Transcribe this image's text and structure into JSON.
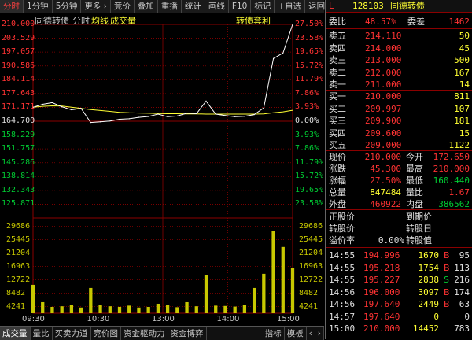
{
  "toolbar": {
    "tabs": [
      "分时",
      "1分钟",
      "5分钟",
      "更多 ›",
      "竞价",
      "叠加",
      "重播",
      "统计",
      "画线",
      "F10",
      "标记",
      "+自选",
      "返回"
    ]
  },
  "chart": {
    "title": "同德转债",
    "mode_label": "分时",
    "avg_label": "均线",
    "vol_label": "成交量",
    "arb_label": "转债套利",
    "price_ticks": [
      "210.000",
      "203.529",
      "197.057",
      "190.586",
      "184.114",
      "177.643",
      "171.171",
      "164.700",
      "158.229",
      "151.757",
      "145.286",
      "138.814",
      "132.343",
      "125.871"
    ],
    "pct_ticks": [
      "27.50%",
      "23.58%",
      "19.65%",
      "15.72%",
      "11.79%",
      "7.86%",
      "3.93%",
      "0.00%",
      "3.93%",
      "7.86%",
      "11.79%",
      "15.72%",
      "19.65%",
      "23.58%"
    ],
    "vol_ticks": [
      "29686",
      "25445",
      "21204",
      "16963",
      "12722",
      "8482",
      "4241"
    ],
    "time_ticks": [
      "09:30",
      "10:30",
      "13:00",
      "14:00",
      "15:00"
    ],
    "colors": {
      "up": "#ff3333",
      "down": "#00cc33",
      "price_line": "#ffffff",
      "avg_line": "#ffff33",
      "volume": "#c8c800"
    }
  },
  "chart_data": {
    "type": "line",
    "prev_close": 164.7,
    "ylim": [
      125.871,
      210.0
    ],
    "x": [
      "09:30",
      "09:40",
      "09:50",
      "10:00",
      "10:10",
      "10:20",
      "10:30",
      "10:40",
      "10:50",
      "11:00",
      "11:10",
      "11:20",
      "11:30/13:00",
      "13:10",
      "13:20",
      "13:30",
      "13:40",
      "13:50",
      "14:00",
      "14:10",
      "14:20",
      "14:30",
      "14:40",
      "14:50",
      "14:53",
      "14:55",
      "14:57",
      "15:00"
    ],
    "series": [
      {
        "values": [
          174.0,
          175.3,
          176.0,
          174.2,
          172.9,
          173.5,
          167.4,
          167.7,
          168.0,
          168.8,
          169.0,
          169.6,
          170.0,
          171.0,
          169.9,
          170.2,
          171.4,
          171.2,
          176.7,
          171.0,
          170.4,
          169.9,
          170.1,
          170.8,
          173.7,
          195.2,
          197.6,
          210.0
        ]
      },
      {
        "values": [
          174.0,
          174.4,
          174.6,
          174.5,
          174.0,
          173.5,
          173.0,
          172.6,
          172.2,
          171.8,
          171.6,
          171.5,
          171.4,
          171.3,
          171.2,
          171.2,
          171.1,
          171.1,
          171.0,
          171.0,
          171.0,
          171.0,
          171.0,
          171.0,
          171.1,
          171.6,
          172.0,
          172.7
        ]
      }
    ],
    "volume": {
      "ylim": [
        0,
        29686
      ],
      "values": [
        9000,
        3500,
        2000,
        2200,
        2500,
        1800,
        8000,
        2600,
        2200,
        2000,
        2400,
        1800,
        2000,
        3000,
        2600,
        1900,
        3500,
        2200,
        12000,
        2400,
        2300,
        2100,
        2600,
        8000,
        12500,
        26000,
        21000,
        14452
      ]
    }
  },
  "panel": {
    "stock": {
      "flag": "L",
      "code": "128103",
      "name": "同德转债"
    },
    "weibi": {
      "label": "委比",
      "value": "48.57%",
      "label2": "委差",
      "value2": "1462"
    },
    "asks": [
      {
        "label": "卖五",
        "price": "214.110",
        "vol": "50"
      },
      {
        "label": "卖四",
        "price": "214.000",
        "vol": "45"
      },
      {
        "label": "卖三",
        "price": "213.000",
        "vol": "500"
      },
      {
        "label": "卖二",
        "price": "212.000",
        "vol": "167"
      },
      {
        "label": "卖一",
        "price": "211.000",
        "vol": "14"
      }
    ],
    "bids": [
      {
        "label": "买一",
        "price": "210.000",
        "vol": "811"
      },
      {
        "label": "买二",
        "price": "209.997",
        "vol": "107"
      },
      {
        "label": "买三",
        "price": "209.900",
        "vol": "181"
      },
      {
        "label": "买四",
        "price": "209.600",
        "vol": "15"
      },
      {
        "label": "买五",
        "price": "209.000",
        "vol": "1122"
      }
    ],
    "stats": [
      {
        "l1": "现价",
        "v1": "210.000",
        "c1": "r",
        "l2": "今开",
        "v2": "172.650",
        "c2": "r"
      },
      {
        "l1": "涨跌",
        "v1": "45.300",
        "c1": "r",
        "l2": "最高",
        "v2": "210.000",
        "c2": "r"
      },
      {
        "l1": "涨幅",
        "v1": "27.50%",
        "c1": "r",
        "l2": "最低",
        "v2": "160.440",
        "c2": "g"
      },
      {
        "l1": "总量",
        "v1": "847484",
        "c1": "y",
        "l2": "量比",
        "v2": "1.67",
        "c2": "r"
      },
      {
        "l1": "外盘",
        "v1": "460922",
        "c1": "r",
        "l2": "内盘",
        "v2": "386562",
        "c2": "g"
      }
    ],
    "conv": [
      {
        "l1": "正股价",
        "v1": "",
        "l2": "到期价",
        "v2": ""
      },
      {
        "l1": "转股价",
        "v1": "",
        "l2": "转股日",
        "v2": ""
      },
      {
        "l1": "溢价率",
        "v1": "0.00%",
        "l2": "转股值",
        "v2": ""
      }
    ],
    "ticks": [
      {
        "time": "14:55",
        "price": "194.996",
        "vol": "1670",
        "side": "B",
        "n": "95"
      },
      {
        "time": "14:55",
        "price": "195.218",
        "vol": "1754",
        "side": "B",
        "n": "113"
      },
      {
        "time": "14:55",
        "price": "195.227",
        "vol": "2838",
        "side": "S",
        "n": "216"
      },
      {
        "time": "14:56",
        "price": "196.000",
        "vol": "3097",
        "side": "B",
        "n": "174"
      },
      {
        "time": "14:56",
        "price": "197.640",
        "vol": "2449",
        "side": "B",
        "n": "63"
      },
      {
        "time": "14:57",
        "price": "197.640",
        "vol": "0",
        "side": "",
        "n": "0"
      },
      {
        "time": "15:00",
        "price": "210.000",
        "vol": "14452",
        "side": "",
        "n": "783"
      }
    ]
  },
  "bottom": {
    "tabs": [
      "成交量",
      "量比",
      "买卖力道",
      "竞价图",
      "资金驱动力",
      "资金博弈"
    ],
    "right_tabs": [
      "指标",
      "模板",
      "‹",
      "›"
    ]
  }
}
